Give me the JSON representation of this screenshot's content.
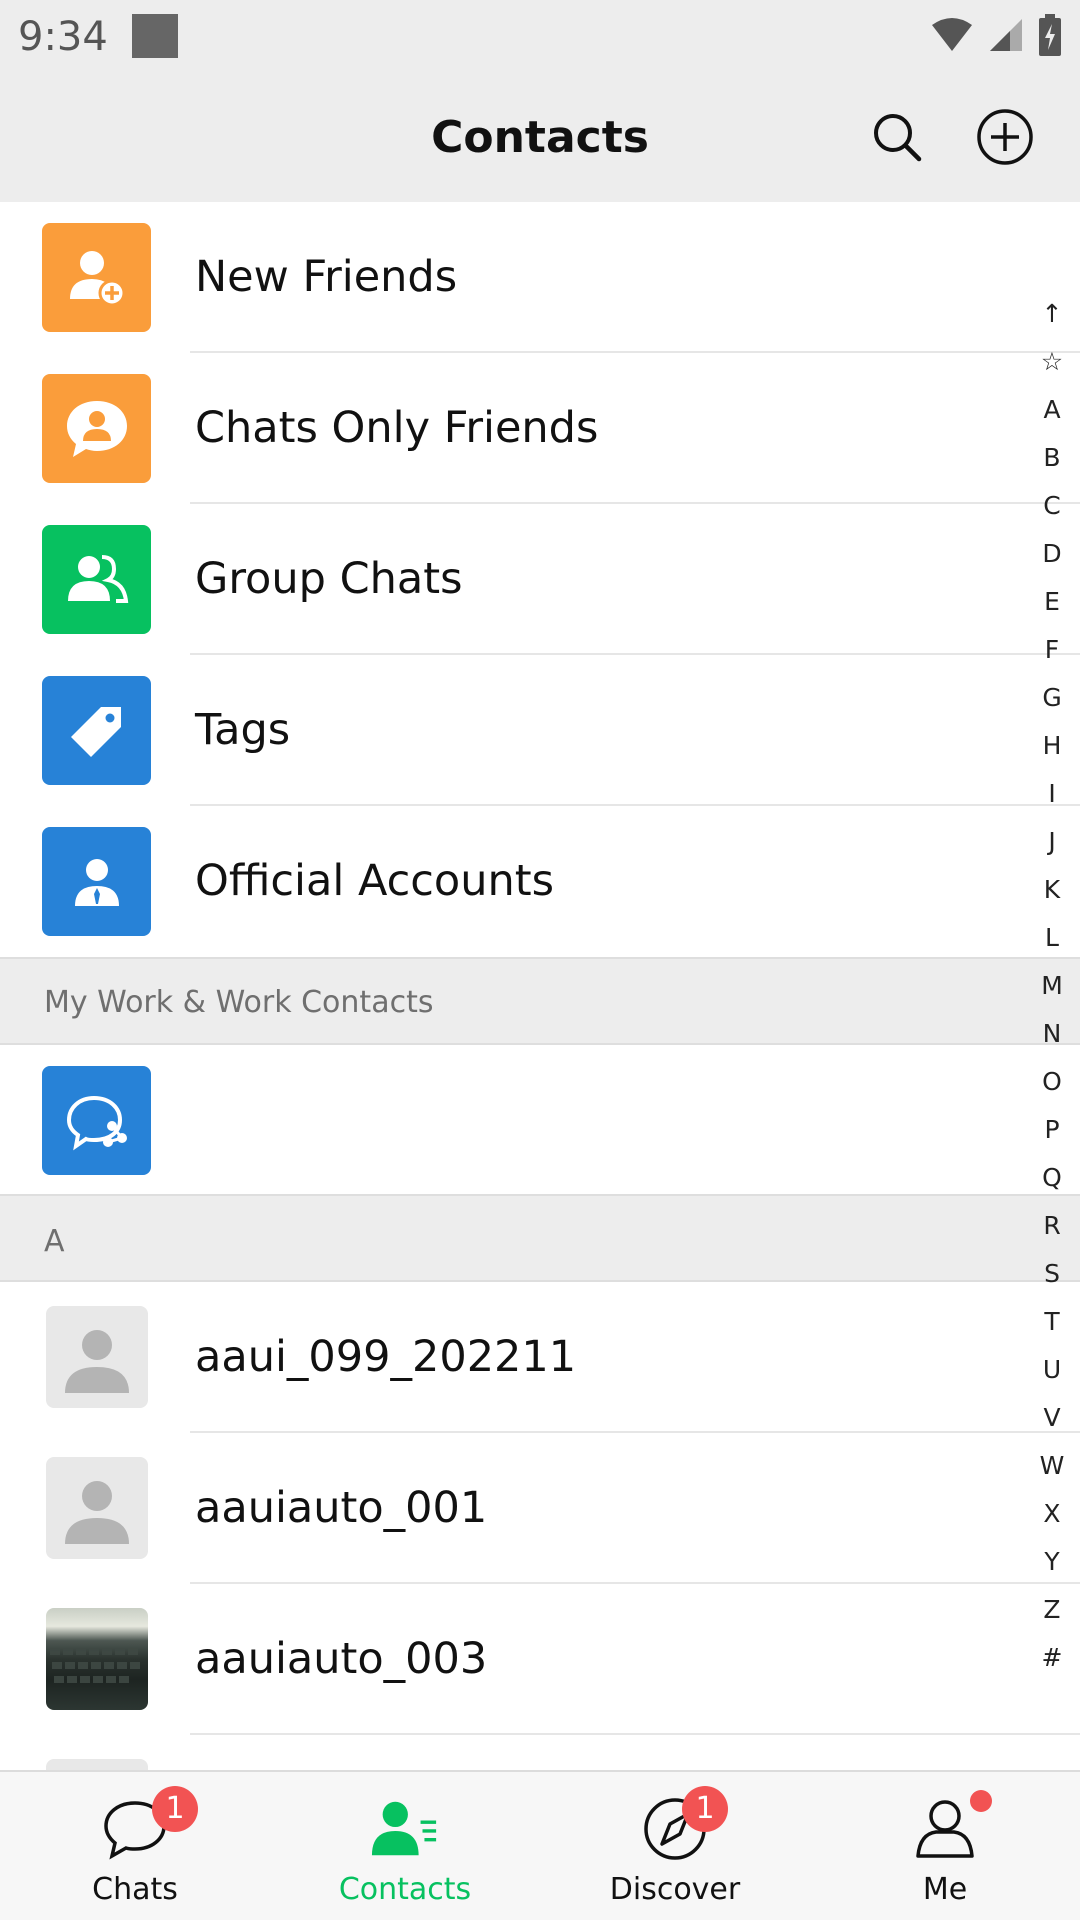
{
  "status_bar": {
    "time": "9:34",
    "icons": [
      "wifi-icon",
      "cell-signal-icon",
      "battery-charging-icon"
    ]
  },
  "header": {
    "title": "Contacts",
    "search_icon": "search-icon",
    "add_icon": "add-circle-icon"
  },
  "feature_rows": [
    {
      "label": "New Friends",
      "icon": "add-friend-icon",
      "color": "#fa9d3b"
    },
    {
      "label": "Chats Only Friends",
      "icon": "chat-person-icon",
      "color": "#fa9d3b"
    },
    {
      "label": "Group Chats",
      "icon": "group-icon",
      "color": "#07c160"
    },
    {
      "label": "Tags",
      "icon": "tag-icon",
      "color": "#2782d7"
    },
    {
      "label": "Official Accounts",
      "icon": "official-account-icon",
      "color": "#2782d7"
    }
  ],
  "work_section": {
    "title": "My Work & Work Contacts",
    "icon": "work-chat-icon",
    "color": "#2782d7"
  },
  "section_a": {
    "letter": "A"
  },
  "contacts": [
    {
      "name": "aaui_099_202211",
      "avatar": "default-avatar-icon"
    },
    {
      "name": "aauiauto_001",
      "avatar": "default-avatar-icon"
    },
    {
      "name": "aauiauto_003",
      "avatar": "photo-avatar"
    }
  ],
  "alphabet_index": [
    "↑",
    "☆",
    "A",
    "B",
    "C",
    "D",
    "E",
    "F",
    "G",
    "H",
    "I",
    "J",
    "K",
    "L",
    "M",
    "N",
    "O",
    "P",
    "Q",
    "R",
    "S",
    "T",
    "U",
    "V",
    "W",
    "X",
    "Y",
    "Z",
    "#"
  ],
  "tabs": [
    {
      "label": "Chats",
      "icon": "chat-bubble-icon",
      "badge": "1",
      "active": false
    },
    {
      "label": "Contacts",
      "icon": "contacts-icon",
      "badge": "",
      "active": true
    },
    {
      "label": "Discover",
      "icon": "compass-icon",
      "badge": "1",
      "active": false
    },
    {
      "label": "Me",
      "icon": "person-icon",
      "badge": "",
      "dot": true,
      "active": false
    }
  ],
  "colors": {
    "accent": "#07c160",
    "badge": "#f25353",
    "orange": "#fa9d3b",
    "blue": "#2782d7"
  }
}
